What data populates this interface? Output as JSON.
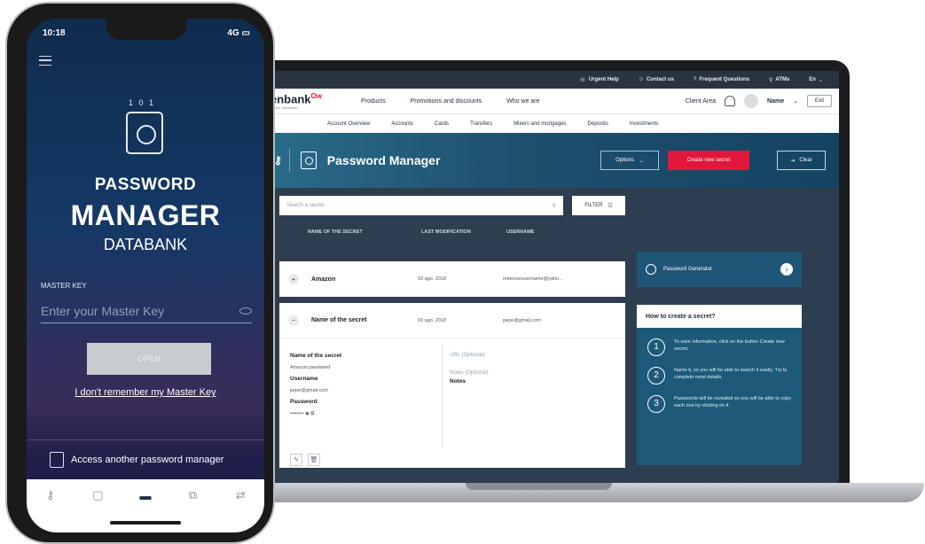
{
  "laptop": {
    "utility_bar": {
      "items": [
        "Urgent Help",
        "Contact us",
        "Frequent Questions",
        "ATMs",
        "En"
      ]
    },
    "nav": {
      "logo": "enbank",
      "logo_mark": "Ow",
      "logo_sub": "Grupo Santander",
      "links": [
        "Products",
        "Promotions and discounts",
        "Who we are"
      ],
      "client_area": "Client Area",
      "user_name": "Name",
      "exit_label": "Exit"
    },
    "subnav": {
      "items": [
        "Account Overview",
        "Accounts",
        "Cards",
        "Transfers",
        "Mixers and mortgages",
        "Deposits",
        "Investments"
      ]
    },
    "hero": {
      "title": "Password Manager",
      "options_label": "Options",
      "create_label": "Create new secret",
      "clear_label": "Clear"
    },
    "search": {
      "placeholder": "Search a secret",
      "filter_label": "FILTER"
    },
    "columns": [
      "NAME OF THE SECRET",
      "LAST MODIFICATION",
      "USERNAME"
    ],
    "rows": [
      {
        "name": "Amazon",
        "date": "03 ago. 2018",
        "user": "nobesonusername@yaho..."
      }
    ],
    "expanded": {
      "name": "Name of the secret",
      "date": "03 ago. 2018",
      "user": "pepe@gmail.com",
      "field_name_label": "Name of the secret",
      "field_name_value": "Amazon password",
      "username_label": "Username",
      "username_value": "pepe@gmail.com",
      "password_label": "Password",
      "password_value": "••••••••",
      "url_label": "URL (Optional)",
      "notes_optional_label": "Notes (Optional)",
      "notes_label": "Notes"
    },
    "side": {
      "generator_label": "Password Generator",
      "howto_title": "How to create a secret?",
      "steps": [
        {
          "num": "1",
          "text": "To save information, click on the button Create new secret."
        },
        {
          "num": "2",
          "text": "Name it, so you will be able to search it easily. Try to complete most details."
        },
        {
          "num": "3",
          "text": "Passwords will be revealed so you will be able to copy each one by clicking on it."
        }
      ]
    }
  },
  "phone": {
    "status_time": "10:18",
    "status_right": "4G",
    "title_line1": "PASSWORD",
    "title_line2": "MANAGER",
    "title_line3": "DATABANK",
    "master_key_label": "MASTER KEY",
    "master_key_placeholder": "Enter your Master Key",
    "open_label": "OPEN",
    "forgot_label": "I don't remember my Master Key",
    "access_label": "Access another password manager",
    "tabs": [
      "key-icon",
      "chat-icon",
      "card-icon",
      "transfer-icon",
      "arrows-icon"
    ]
  },
  "colors": {
    "accent_red": "#e2173b",
    "hero_blue": "#1e4f6d",
    "dark_bg": "#2d3e50"
  }
}
